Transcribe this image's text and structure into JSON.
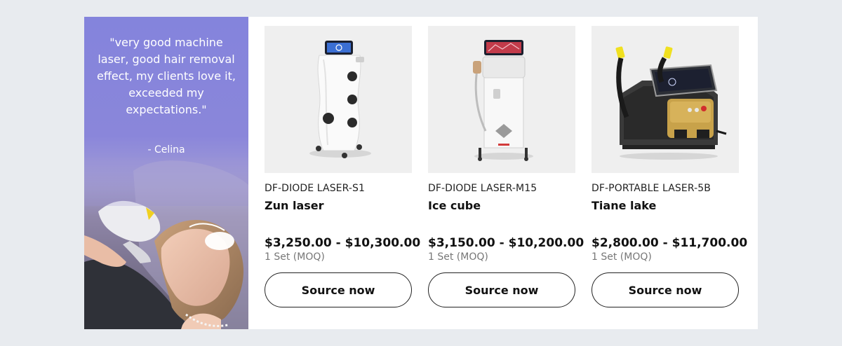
{
  "testimonial": {
    "quote": "\"very good machine laser, good hair removal effect, my clients love it, exceeded my expectations.\"",
    "author": "- Celina"
  },
  "products": [
    {
      "model": "DF-DIODE LASER-S1",
      "name": "Zun laser",
      "price": "$3,250.00 - $10,300.00",
      "moq": "1 Set (MOQ)",
      "button_label": "Source now"
    },
    {
      "model": "DF-DIODE LASER-M15",
      "name": "Ice cube",
      "price": "$3,150.00 - $10,200.00",
      "moq": "1 Set (MOQ)",
      "button_label": "Source now"
    },
    {
      "model": "DF-PORTABLE LASER-5B",
      "name": "Tiane lake",
      "price": "$2,800.00 - $11,700.00",
      "moq": "1 Set (MOQ)",
      "button_label": "Source now"
    }
  ]
}
